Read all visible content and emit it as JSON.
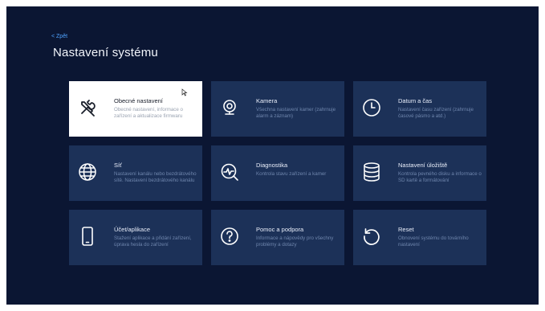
{
  "header": {
    "back_label": "< Zpět",
    "title": "Nastavení systému"
  },
  "tiles": [
    {
      "title": "Obecné nastavení",
      "desc": "Obecné nastavení, informace o zařízení a aktualizace firmwaru",
      "icon": "tools-icon",
      "active": true
    },
    {
      "title": "Kamera",
      "desc": "Všechna nastavení kamer (zahrnuje alarm a záznam)",
      "icon": "camera-icon"
    },
    {
      "title": "Datum a čas",
      "desc": "Nastavení času zařízení (zahrnuje časové pásmo a atd.)",
      "icon": "clock-icon"
    },
    {
      "title": "Síť",
      "desc": "Nastavení kanálu nebo bezdrátového sítě. Nastavení bezdrátového kanálu",
      "icon": "globe-icon"
    },
    {
      "title": "Diagnostika",
      "desc": "Kontrola stavu zařízení a kamer",
      "icon": "diagnostics-icon"
    },
    {
      "title": "Nastavení úložiště",
      "desc": "Kontrola pevného disku a informace o SD kartě a formátování",
      "icon": "database-icon"
    },
    {
      "title": "Účet/aplikace",
      "desc": "Stažení aplikace a přidání zařízení, úprava hesla do zařízení",
      "icon": "phone-icon"
    },
    {
      "title": "Pomoc a podpora",
      "desc": "Informace a nápovědy pro všechny problémy a dotazy",
      "icon": "help-icon"
    },
    {
      "title": "Reset",
      "desc": "Obnovení systému do továrního nastavení",
      "icon": "reset-icon"
    }
  ],
  "colors": {
    "background": "#0b1633",
    "tile": "#1c3158",
    "tile_active": "#ffffff",
    "accent": "#4fa3ff"
  }
}
